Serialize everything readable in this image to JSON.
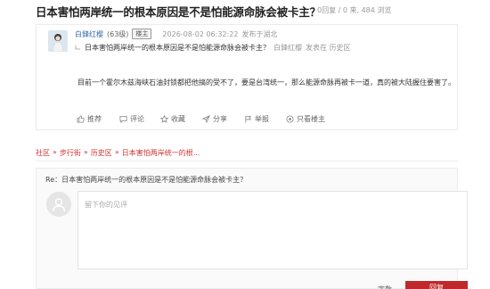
{
  "thread": {
    "title": "日本害怕两岸统一的根本原因是不是怕能源命脉会被卡主？",
    "stats": "0回复 / 0 来, 484 浏览"
  },
  "post": {
    "author": "白鋒红樱",
    "level": "(63级)",
    "host_badge": "楼主",
    "time": "2026-08-02 06:32:22",
    "location": "发布于湖北",
    "ref_title": "日本害怕两岸统一的根本原因是不是怕能源命脉会被卡主？",
    "ref_author": "白鋒红樱",
    "ref_board": "发表在 历史区",
    "content": "目前一个霍尔木兹海峡石油封锁都把他搞的受不了，要是台湾统一，那么能源命脉再被卡一道，真的被大陆握住要害了。",
    "actions": {
      "recommend": "推荐",
      "comment": "评论",
      "favorite": "收藏",
      "share": "分享",
      "report": "举报",
      "author_only": "只看楼主"
    }
  },
  "breadcrumb": {
    "items": [
      "社区",
      "步行街",
      "历史区",
      "日本害怕两岸统一的根..."
    ],
    "separator": "»"
  },
  "reply": {
    "label": "Re：日本害怕两岸统一的根本原因是不是怕能源命脉会被卡主？",
    "placeholder": "留下你的见评",
    "footer_link": "字数",
    "submit_label": "回复"
  },
  "colors": {
    "accent": "#c0292b",
    "author_link": "#3a6ea5"
  }
}
